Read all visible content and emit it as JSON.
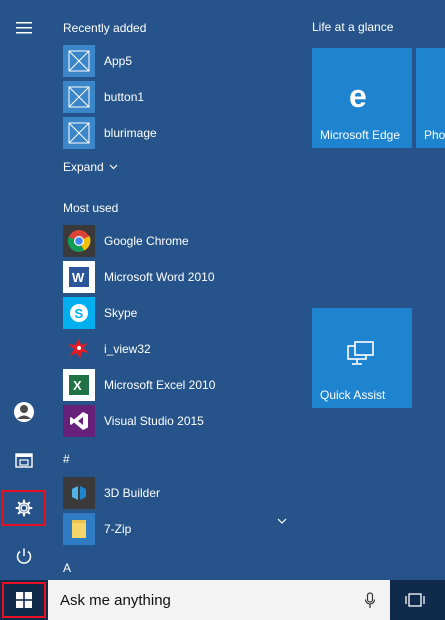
{
  "recently_added": {
    "header": "Recently added",
    "items": [
      {
        "label": "App5"
      },
      {
        "label": "button1"
      },
      {
        "label": "blurimage"
      }
    ]
  },
  "expand": {
    "label": "Expand"
  },
  "most_used": {
    "header": "Most used",
    "items": [
      {
        "label": "Google Chrome",
        "icon": "chrome-icon"
      },
      {
        "label": "Microsoft Word 2010",
        "icon": "word-icon"
      },
      {
        "label": "Skype",
        "icon": "skype-icon"
      },
      {
        "label": "i_view32",
        "icon": "irfanview-icon"
      },
      {
        "label": "Microsoft Excel 2010",
        "icon": "excel-icon"
      },
      {
        "label": "Visual Studio 2015",
        "icon": "visual-studio-icon"
      }
    ]
  },
  "alpha_sections": {
    "hash": "#",
    "a": "A",
    "hash_items": [
      {
        "label": "3D Builder",
        "icon": "3d-builder-icon"
      },
      {
        "label": "7-Zip",
        "icon": "folder-icon"
      }
    ]
  },
  "tiles": {
    "header": "Life at a glance",
    "edge_label": "Microsoft Edge",
    "photos_label": "Photos",
    "quick_assist_label": "Quick Assist"
  },
  "taskbar": {
    "search_placeholder": "Ask me anything"
  },
  "colors": {
    "menu_bg": "#26548a",
    "tile": "#1e84d0",
    "highlight": "#e81123"
  }
}
